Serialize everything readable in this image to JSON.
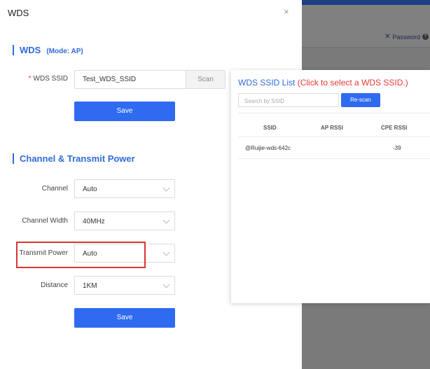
{
  "background": {
    "password_link": "Password",
    "password_icon": "tools-icon",
    "help_icon": "help-icon"
  },
  "drawer": {
    "title": "WDS",
    "close_icon": "×"
  },
  "wds_section": {
    "title": "WDS",
    "mode": "(Mode: AP)",
    "ssid_label": "WDS SSID",
    "ssid_required_mark": "*",
    "ssid_value": "Test_WDS_SSID",
    "scan_label": "Scan",
    "save_label": "Save"
  },
  "channel_section": {
    "title": "Channel & Transmit Power",
    "fields": [
      {
        "label": "Channel",
        "value": "Auto"
      },
      {
        "label": "Channel Width",
        "value": "40MHz"
      },
      {
        "label": "Transmit Power",
        "value": "Auto"
      },
      {
        "label": "Distance",
        "value": "1KM"
      }
    ],
    "save_label": "Save"
  },
  "ssid_list": {
    "title": "WDS SSID List",
    "hint": "(Click to select a WDS SSID.)",
    "search_placeholder": "Search by SSID",
    "rescan_label": "Re-scan",
    "columns": [
      "SSID",
      "AP RSSI",
      "CPE RSSI"
    ],
    "rows": [
      {
        "ssid": "@Ruijie-wds-642c",
        "ap_rssi": "",
        "cpe_rssi": "-39"
      }
    ]
  },
  "colors": {
    "accent": "#2f6bd9",
    "button": "#2f6bf0",
    "required": "#e53935",
    "highlight": "#d93434"
  }
}
